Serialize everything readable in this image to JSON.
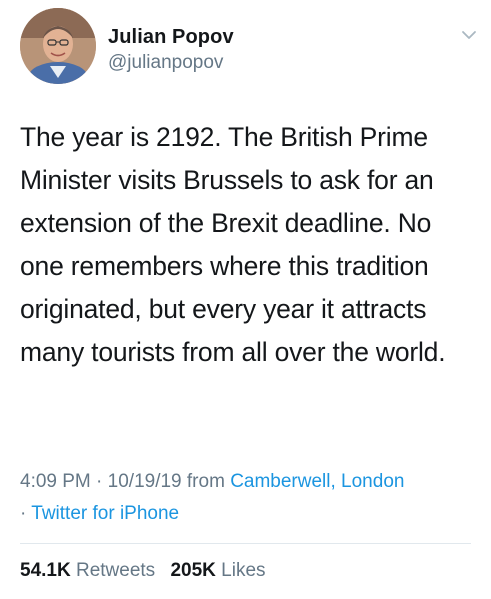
{
  "user": {
    "name": "Julian Popov",
    "handle": "@julianpopov"
  },
  "tweet": {
    "text": "The year is 2192. The British Prime Minister visits Brussels to ask for an extension of the Brexit deadline. No one remembers where this tradition originated, but every year it attracts many tourists from all over the world."
  },
  "meta": {
    "time": "4:09 PM",
    "separator": " · ",
    "date": "10/19/19",
    "from_label": " from ",
    "location": "Camberwell, London",
    "source_sep": "· ",
    "source": "Twitter for iPhone"
  },
  "stats": {
    "retweets_count": "54.1K",
    "retweets_label": " Retweets",
    "likes_count": "205K",
    "likes_label": " Likes"
  },
  "colors": {
    "text": "#14171a",
    "secondary": "#657786",
    "link": "#1b95e0",
    "divider": "#e1e8ed"
  },
  "icons": {
    "menu": "chevron-down-icon"
  }
}
